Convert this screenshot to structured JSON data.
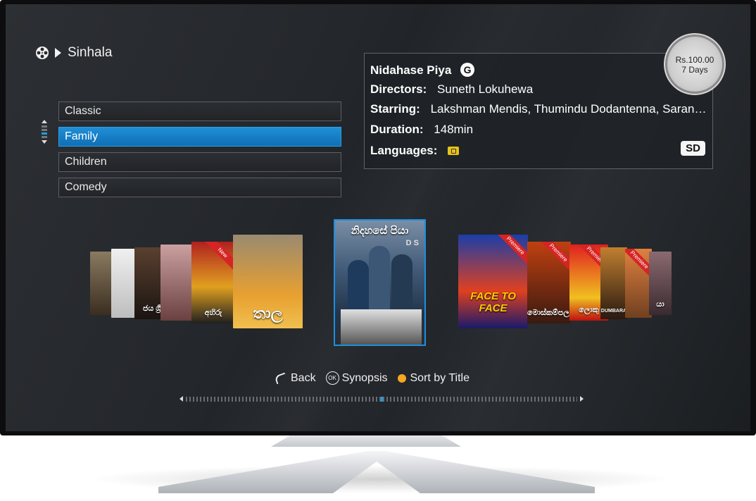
{
  "header": {
    "category": "Sinhala"
  },
  "categories": [
    {
      "label": "Classic",
      "selected": false
    },
    {
      "label": "Family",
      "selected": true
    },
    {
      "label": "Children",
      "selected": false
    },
    {
      "label": "Comedy",
      "selected": false
    }
  ],
  "movie": {
    "title": "Nidahase Piya",
    "rating": "G",
    "directors_label": "Directors:",
    "directors": "Suneth Lokuhewa",
    "starring_label": "Starring:",
    "starring": "Lakshman Mendis, Thumindu Dodantenna, Saran…",
    "duration_label": "Duration:",
    "duration": "148min",
    "languages_label": "Languages:",
    "quality": "SD",
    "price": "Rs.100.00",
    "rental_period": "7 Days"
  },
  "posters": {
    "center_title": "නිදහසේ පියා",
    "center_subtitle": "D S",
    "left_titles": [
      "",
      "",
      "ජය ශ්‍රී",
      "",
      "අහිරු",
      "තාල"
    ],
    "right_titles": [
      "FACE TO FACE",
      "මොස්කම්පලය",
      "ලොකු",
      "DUMBARA",
      "",
      "යා"
    ],
    "premiere_label": "Premiere",
    "new_label": "New"
  },
  "hints": {
    "back": "Back",
    "ok_icon": "OK",
    "synopsis": "Synopsis",
    "sort": "Sort by Title"
  },
  "colors": {
    "accent": "#1c8fe0",
    "yellow_key": "#f5a623",
    "premiere": "#d62424"
  }
}
